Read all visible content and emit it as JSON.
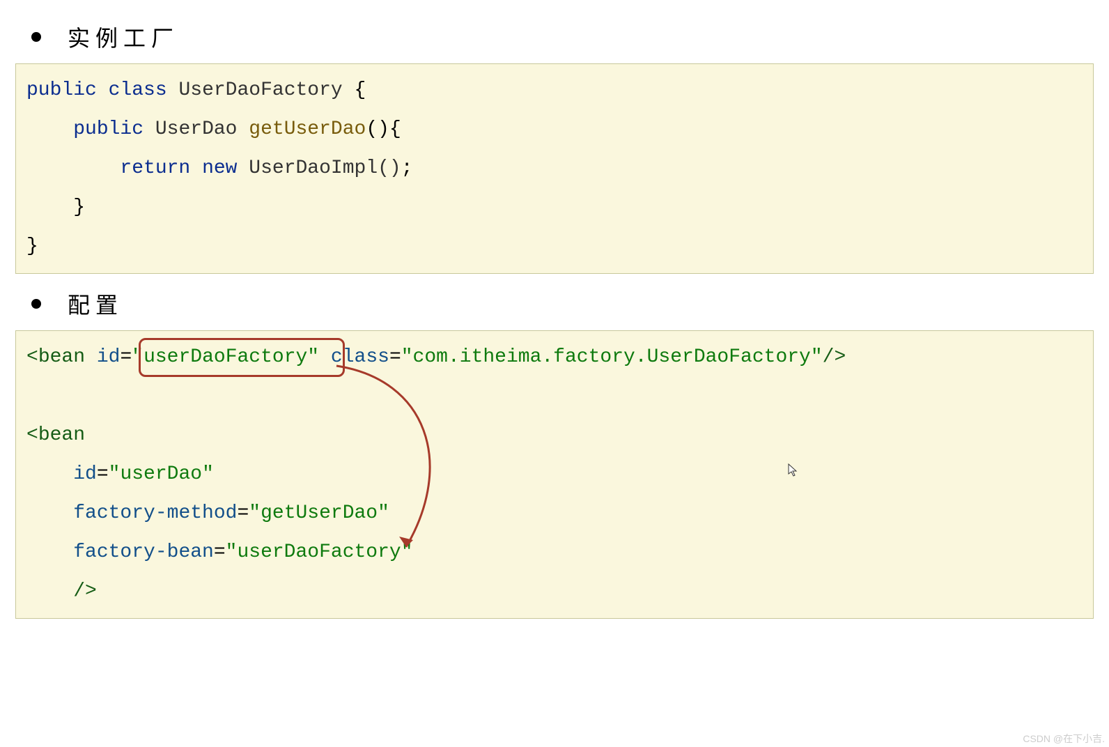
{
  "sections": {
    "title1": "实例工厂",
    "title2": "配置"
  },
  "code1": {
    "tok": {
      "public1": "public",
      "class": "class",
      "className": "UserDaoFactory",
      "brace1": "{",
      "public2": "public",
      "retType": "UserDao",
      "method": "getUserDao",
      "parens": "()",
      "brace2": "{",
      "return": "return",
      "new": "new",
      "impl": "UserDaoImpl()",
      "semi": ";",
      "brace3": "}",
      "brace4": "}"
    }
  },
  "code2": {
    "tok": {
      "lt1": "<",
      "bean1": "bean",
      "id1attr": "id",
      "eq": "=",
      "id1val": "\"userDaoFactory\"",
      "class1attr": "class",
      "class1val": "\"com.itheima.factory.UserDaoFactory\"",
      "close1": "/>",
      "lt2": "<",
      "bean2": "bean",
      "id2attr": "id",
      "id2val": "\"userDao\"",
      "fmattr": "factory-method",
      "fmval": "\"getUserDao\"",
      "fbattr": "factory-bean",
      "fbval": "\"userDaoFactory\"",
      "close2": "/>"
    }
  },
  "watermark": "CSDN @在下小吉."
}
